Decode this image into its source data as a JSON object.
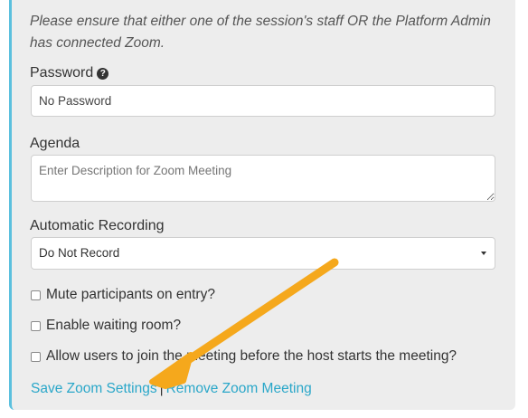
{
  "notice": "Please ensure that either one of the session's staff OR the Platform Admin has connected Zoom.",
  "password": {
    "label": "Password",
    "help_icon": "question-circle-icon",
    "value": "No Password"
  },
  "agenda": {
    "label": "Agenda",
    "placeholder": "Enter Description for Zoom Meeting"
  },
  "recording": {
    "label": "Automatic Recording",
    "selected": "Do Not Record"
  },
  "options": [
    {
      "label": "Mute participants on entry?",
      "checked": false
    },
    {
      "label": "Enable waiting room?",
      "checked": false
    },
    {
      "label": "Allow users to join the meeting before the host starts the meeting?",
      "checked": false
    }
  ],
  "actions": {
    "save": "Save Zoom Settings",
    "separator": "|",
    "remove": "Remove Zoom Meeting"
  },
  "colors": {
    "accent_border": "#5bc0de",
    "link": "#2aa7c9",
    "arrow": "#f5a81c"
  }
}
